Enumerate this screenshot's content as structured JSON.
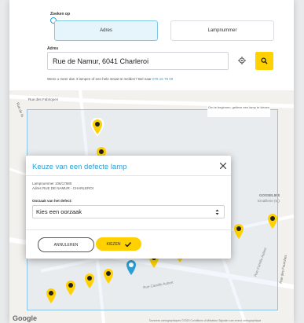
{
  "search": {
    "label": "Zoeken op",
    "options": [
      "Adres",
      "Lampnummer"
    ],
    "selected": "Adres"
  },
  "address": {
    "label": "Adres",
    "value": "Rue de Namur, 6041 Charleroi"
  },
  "help": {
    "text": "Wens u meer dan 3 lampen of een hele straat te melden? Bel naar",
    "phone": "078 15 78 00"
  },
  "map": {
    "streets": [
      "Rue des Fabriques",
      "Rue de la",
      "GOSSELIES",
      "Emaillerie (M)",
      "Rue Camille Aubert",
      "Rue des Fourches",
      "Rue Camille Aubert"
    ],
    "hint": "Om te beginnen, gelieve een lamp te kiezen",
    "attribution": "Donnees cartographiques ©2020   Conditions d'utilisation   Signaler une erreur cartographique",
    "google": "Google",
    "pin_color": "#ffd100",
    "selected_pin_color": "#2a9fd6",
    "area_color": "#8ac4ea"
  },
  "modal": {
    "title": "Keuze van een defecte lamp",
    "lamp_line1": "Lampnummer 106/17680",
    "lamp_line2": "Adres RUE DE NAMUR - CHARLEROI",
    "cause_label": "Oorzaak van het defect:",
    "cause_value": "Kies een oorzaak",
    "cancel_label": "ANNULEREN",
    "choose_label": "KIEZEN"
  },
  "colors": {
    "accent": "#2a9fd6",
    "brand": "#ffd100"
  }
}
